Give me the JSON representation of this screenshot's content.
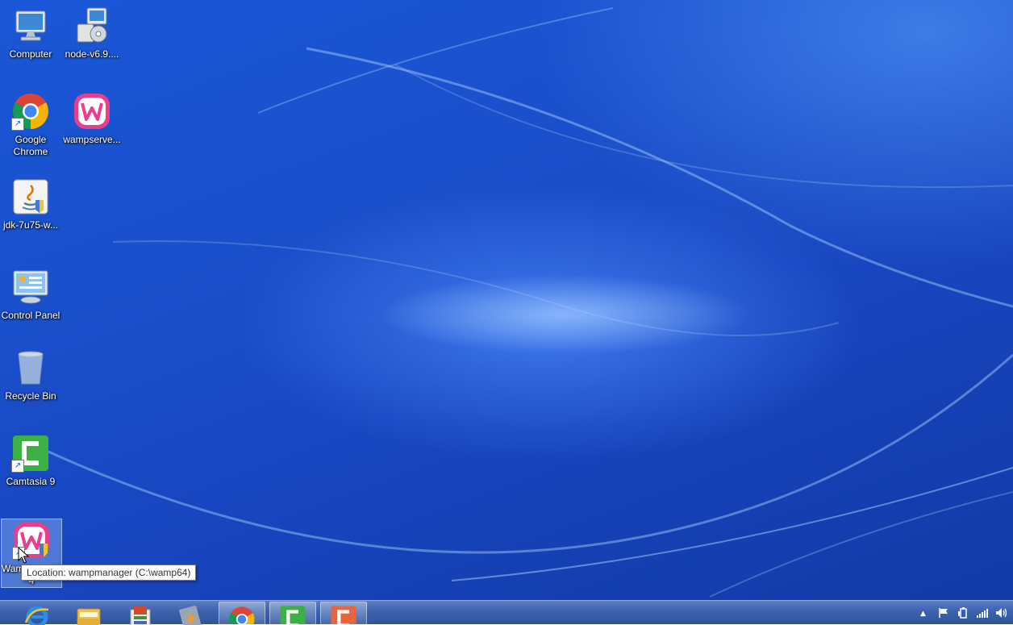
{
  "desktop": {
    "icons": [
      {
        "label": "Computer"
      },
      {
        "label": "node-v6.9...."
      },
      {
        "label": "Google Chrome"
      },
      {
        "label": "wampserve..."
      },
      {
        "label": "jdk-7u75-w..."
      },
      {
        "label": "Control Panel"
      },
      {
        "label": "Recycle Bin"
      },
      {
        "label": "Camtasia 9"
      },
      {
        "label": "Wampserver64"
      }
    ],
    "tooltip": "Location: wampmanager (C:\\wamp64)"
  },
  "taskbar": {
    "pinned": [
      {
        "icon": "internet-explorer-icon"
      },
      {
        "icon": "file-explorer-icon"
      },
      {
        "icon": "installer-icon"
      },
      {
        "icon": "media-player-icon"
      },
      {
        "icon": "google-chrome-icon"
      },
      {
        "icon": "camtasia-icon"
      },
      {
        "icon": "camtasia-recorder-icon"
      }
    ],
    "tray": [
      "show-hidden-icons-arrow",
      "action-center-flag-icon",
      "power-icon",
      "network-signal-icon",
      "volume-icon"
    ]
  },
  "colors": {
    "desktop_blue": "#1a4fcb",
    "taskbar": "#3c62ad",
    "wamp_pink": "#e83e8c",
    "camtasia_green": "#3cb043",
    "camtasia_orange": "#e8643c"
  }
}
